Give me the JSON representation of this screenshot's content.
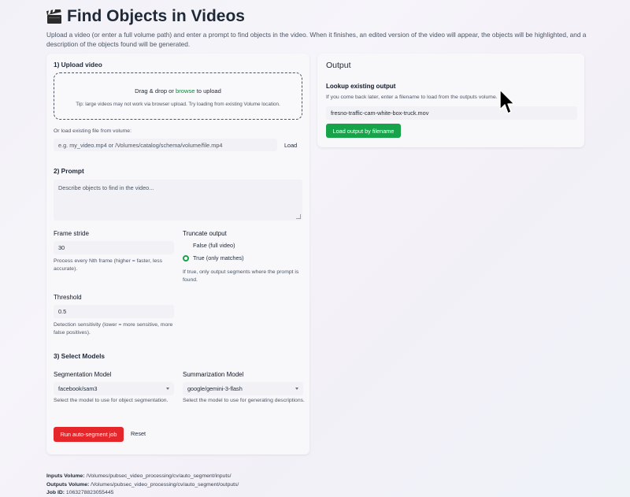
{
  "page": {
    "title": "Find Objects in Videos",
    "subtitle": "Upload a video (or enter a full volume path) and enter a prompt to find objects in the video. When it finishes, an edited version of the video will appear, the objects will be highlighted, and a description of the objects found will be generated."
  },
  "upload": {
    "section_title": "1) Upload video",
    "drag_prefix": "Drag & drop or ",
    "browse_label": "browse",
    "drag_suffix": " to upload",
    "tip": "Tip: large videos may not work via browser upload. Try loading from existing Volume location.",
    "volume_label": "Or load existing file from volume:",
    "volume_placeholder": "e.g. my_video.mp4 or /Volumes/catalog/schema/volume/file.mp4",
    "load_label": "Load"
  },
  "prompt": {
    "section_title": "2) Prompt",
    "placeholder": "Describe objects to find in the video..."
  },
  "frame_stride": {
    "label": "Frame stride",
    "value": "30",
    "help": "Process every Nth frame (higher = faster, less accurate)."
  },
  "truncate": {
    "label": "Truncate output",
    "option_false": "False (full video)",
    "option_true": "True (only matches)",
    "selected": "true",
    "help": "If true, only output segments where the prompt is found."
  },
  "threshold": {
    "label": "Threshold",
    "value": "0.5",
    "help": "Detection sensitivity (lower = more sensitive, more false positives)."
  },
  "models": {
    "section_title": "3) Select Models",
    "segmentation_label": "Segmentation Model",
    "segmentation_value": "facebook/sam3",
    "segmentation_help": "Select the model to use for object segmentation.",
    "summarization_label": "Summarization Model",
    "summarization_value": "google/gemini-3-flash",
    "summarization_help": "Select the model to use for generating descriptions."
  },
  "actions": {
    "run_label": "Run auto-segment job",
    "reset_label": "Reset"
  },
  "output": {
    "title": "Output",
    "lookup_title": "Lookup existing output",
    "lookup_help": "If you come back later, enter a filename to load from the outputs volume.",
    "filename_value": "fresno-traffic-cam-white-box-truck.mov",
    "load_button": "Load output by filename"
  },
  "footer": {
    "inputs_label": "Inputs Volume:",
    "inputs_value": " /Volumes/pubsec_video_processing/cv/auto_segment/inputs/",
    "outputs_label": "Outputs Volume:",
    "outputs_value": " /Volumes/pubsec_video_processing/cv/auto_segment/outputs/",
    "job_label": "Job ID:",
    "job_value": " 1063278823055445"
  },
  "colors": {
    "accent_green": "#16a34a",
    "run_red": "#e5262a"
  },
  "icons": {
    "title_icon": "clapperboard-icon",
    "cursor": "mouse-pointer-icon"
  }
}
